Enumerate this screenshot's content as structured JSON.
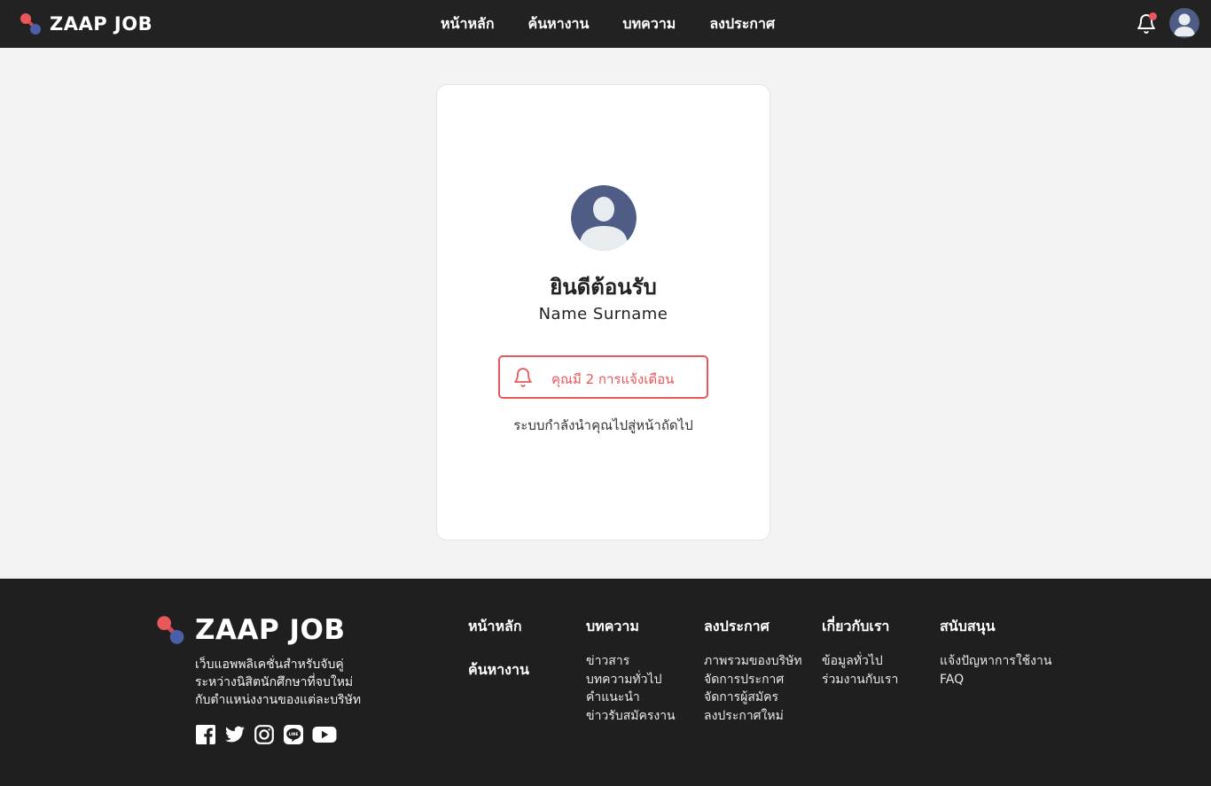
{
  "header": {
    "logo_text": "ZAAP JOB",
    "nav": [
      "หน้าหลัก",
      "ค้นหางาน",
      "บทความ",
      "ลงประกาศ"
    ]
  },
  "card": {
    "welcome": "ยินดีต้อนรับ",
    "user_name": "Name Surname",
    "notification_button": "คุณมี 2 การแจ้งเตือน",
    "redirect_message": "ระบบกำลังนำคุณไปสู่หน้าถัดไป"
  },
  "footer": {
    "logo_text": "ZAAP JOB",
    "tagline": [
      "เว็บแอพพลิเคชั่นสำหรับจับคู่",
      "ระหว่างนิสิตนักศึกษาที่จบใหม่",
      "กับตำแหน่งงานของแต่ละบริษัท"
    ],
    "socials": [
      "facebook-icon",
      "twitter-icon",
      "instagram-icon",
      "line-icon",
      "youtube-icon"
    ],
    "columns": [
      {
        "heading": "หน้าหลัก",
        "heading2": "ค้นหางาน"
      },
      {
        "heading": "บทความ",
        "links": [
          "ข่าวสาร",
          "บทความทั่วไป",
          "คำแนะนำ",
          "ข่าวรับสมัครงาน"
        ]
      },
      {
        "heading": "ลงประกาศ",
        "links": [
          "ภาพรวมของบริษัท",
          "จัดการประกาศ",
          "จัดการผู้สมัคร",
          "ลงประกาศใหม่"
        ]
      },
      {
        "heading": "เกี่ยวกับเรา",
        "links": [
          "ข้อมูลทั่วไป",
          "ร่วมงานกับเรา"
        ]
      },
      {
        "heading": "สนับสนุน",
        "links": [
          "แจ้งปัญหาการใช้งาน",
          "FAQ"
        ]
      }
    ]
  },
  "colors": {
    "header_bg": "#222222",
    "footer_bg": "#1f1f1f",
    "accent_red": "#e8575a",
    "accent_blue": "#4a5fa8",
    "avatar_bg": "#4f5d86"
  }
}
